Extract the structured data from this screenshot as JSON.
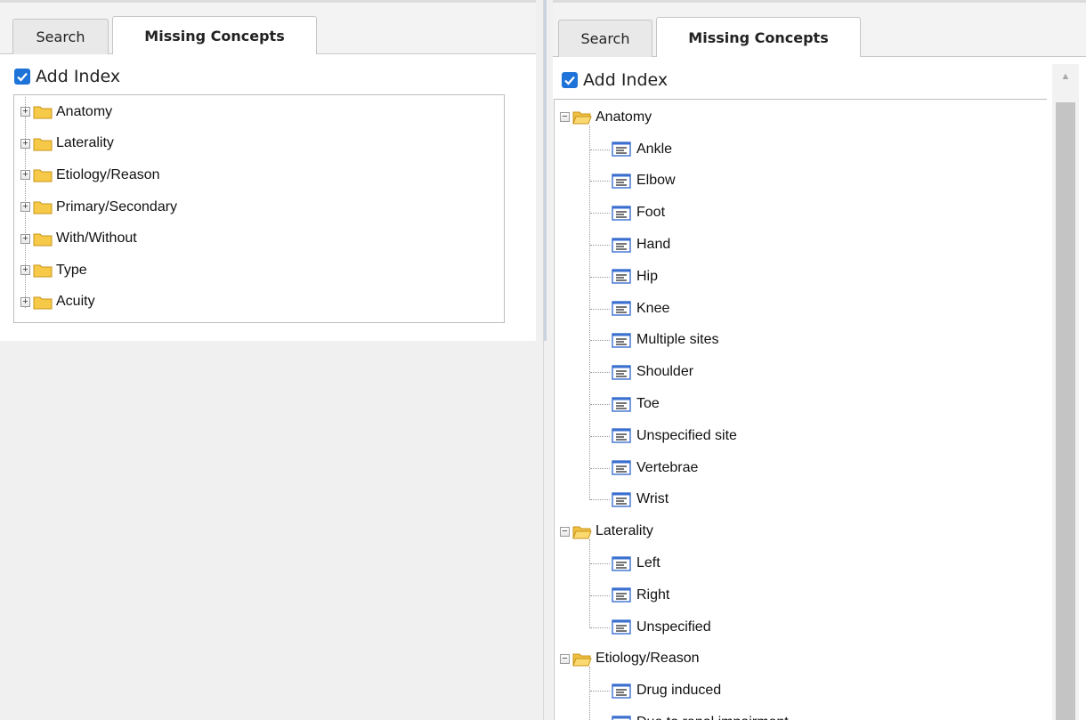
{
  "left_panel": {
    "tabs": [
      {
        "label": "Search",
        "active": false
      },
      {
        "label": "Missing Concepts",
        "active": true
      }
    ],
    "add_index": {
      "label": "Add Index",
      "checked": true
    },
    "tree": [
      {
        "label": "Anatomy",
        "expanded": false
      },
      {
        "label": "Laterality",
        "expanded": false
      },
      {
        "label": "Etiology/Reason",
        "expanded": false
      },
      {
        "label": "Primary/Secondary",
        "expanded": false
      },
      {
        "label": "With/Without",
        "expanded": false
      },
      {
        "label": "Type",
        "expanded": false
      },
      {
        "label": "Acuity",
        "expanded": false
      }
    ]
  },
  "right_panel": {
    "tabs": [
      {
        "label": "Search",
        "active": false
      },
      {
        "label": "Missing Concepts",
        "active": true
      }
    ],
    "add_index": {
      "label": "Add Index",
      "checked": true
    },
    "tree": [
      {
        "label": "Anatomy",
        "expanded": true,
        "children": [
          "Ankle",
          "Elbow",
          "Foot",
          "Hand",
          "Hip",
          "Knee",
          "Multiple sites",
          "Shoulder",
          "Toe",
          "Unspecified site",
          "Vertebrae",
          "Wrist"
        ]
      },
      {
        "label": "Laterality",
        "expanded": true,
        "children": [
          "Left",
          "Right",
          "Unspecified"
        ]
      },
      {
        "label": "Etiology/Reason",
        "expanded": true,
        "children": [
          "Drug induced",
          "Due to renal impairment"
        ]
      }
    ]
  },
  "icons": {
    "expand": "plus-box-icon",
    "collapse": "minus-box-icon",
    "folder": "folder-icon",
    "concept": "concept-leaf-icon",
    "checkbox": "checkmark-icon"
  },
  "colors": {
    "checkbox": "#1e73d8",
    "folder": "#f7c948",
    "concept_icon": "#3a6fd0"
  }
}
